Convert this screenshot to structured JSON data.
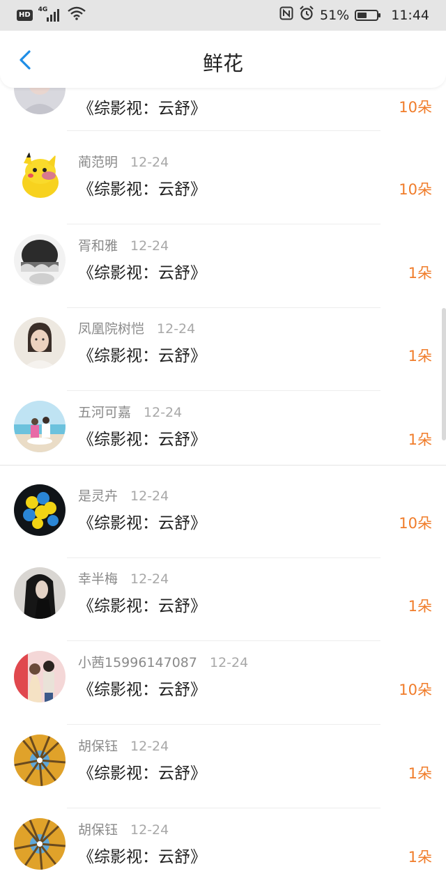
{
  "status_bar": {
    "hd": "HD",
    "network": "4G",
    "battery_percent": "51%",
    "battery_level": 0.51,
    "time": "11:44",
    "icons": [
      "nfc-icon",
      "alarm-icon",
      "leaf-battery-icon",
      "wifi-icon",
      "signal-icon"
    ]
  },
  "header": {
    "title": "鲜花",
    "back_icon": "chevron-left-icon"
  },
  "colors": {
    "accent": "#f07c2a",
    "back_blue": "#1e8de6",
    "name_gray": "#8a8a8a"
  },
  "items": [
    {
      "name": "",
      "date": "",
      "book": "《综影视：云舒》",
      "count": "10朵"
    },
    {
      "name": "蔺范明",
      "date": "12-24",
      "book": "《综影视：云舒》",
      "count": "10朵"
    },
    {
      "name": "胥和雅",
      "date": "12-24",
      "book": "《综影视：云舒》",
      "count": "1朵"
    },
    {
      "name": "凤凰院树恺",
      "date": "12-24",
      "book": "《综影视：云舒》",
      "count": "1朵"
    },
    {
      "name": "五河可嘉",
      "date": "12-24",
      "book": "《综影视：云舒》",
      "count": "1朵"
    },
    {
      "name": "是灵卉",
      "date": "12-24",
      "book": "《综影视：云舒》",
      "count": "10朵"
    },
    {
      "name": "幸半梅",
      "date": "12-24",
      "book": "《综影视：云舒》",
      "count": "1朵"
    },
    {
      "name": "小茜15996147087",
      "date": "12-24",
      "book": "《综影视：云舒》",
      "count": "10朵"
    },
    {
      "name": "胡保钰",
      "date": "12-24",
      "book": "《综影视：云舒》",
      "count": "1朵"
    },
    {
      "name": "胡保钰",
      "date": "12-24",
      "book": "《综影视：云舒》",
      "count": "1朵"
    }
  ]
}
